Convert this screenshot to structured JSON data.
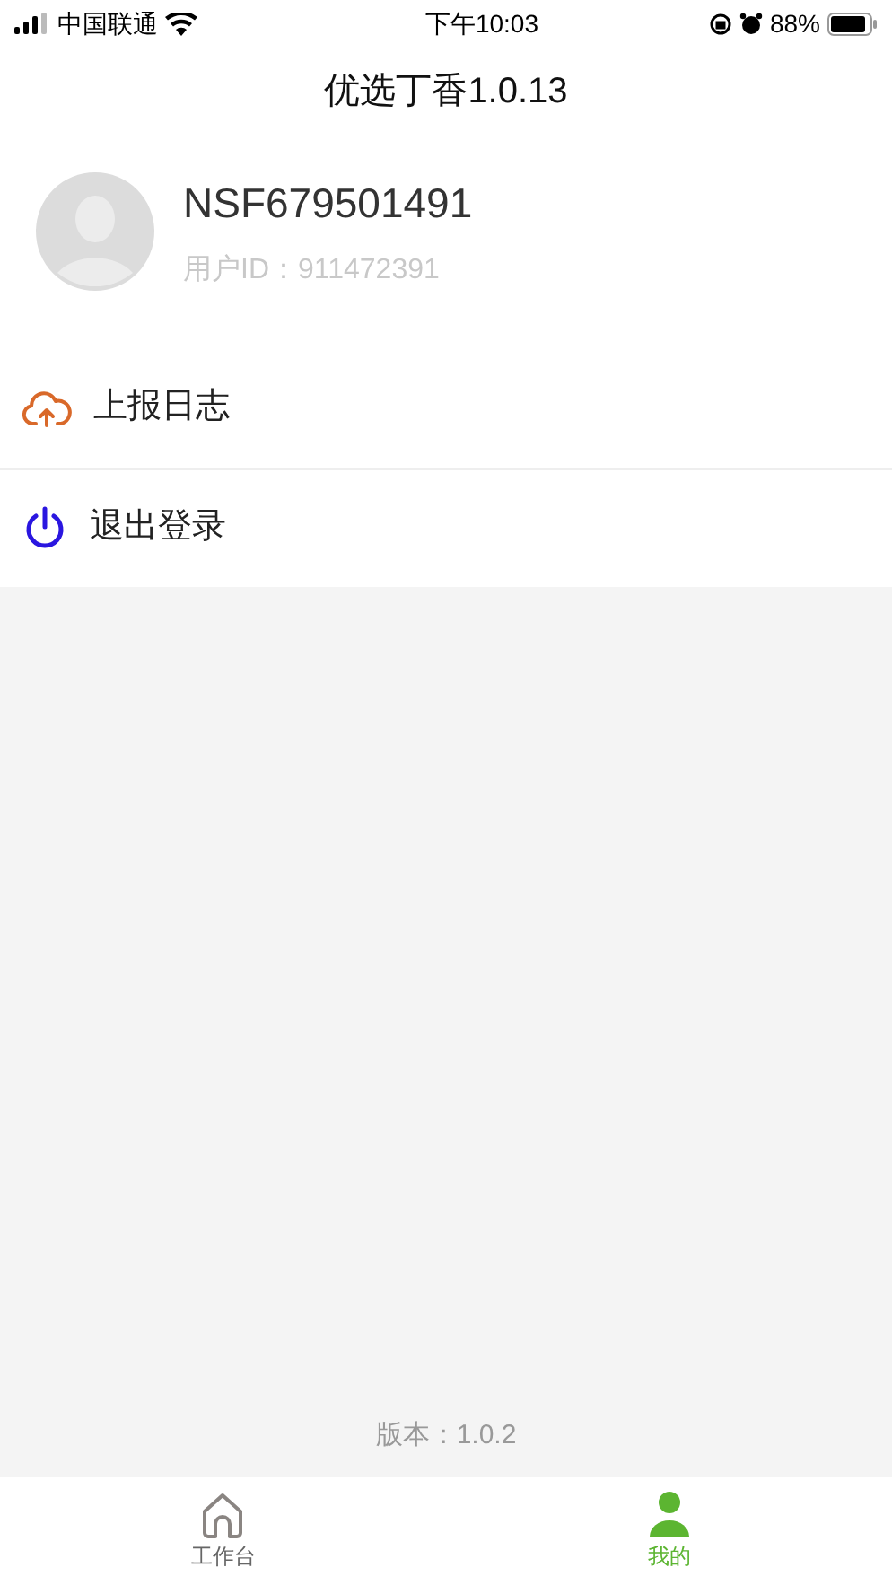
{
  "status_bar": {
    "carrier": "中国联通",
    "time": "下午10:03",
    "battery": "88%"
  },
  "header": {
    "title": "优选丁香1.0.13"
  },
  "profile": {
    "name": "NSF679501491",
    "user_id": "用户ID：911472391"
  },
  "menu": [
    {
      "kind": "upload",
      "label": "上报日志"
    },
    {
      "kind": "logout",
      "label": "退出登录"
    }
  ],
  "version": "版本：1.0.2",
  "tab_bar": [
    {
      "kind": "home",
      "label": "工作台",
      "selected": false
    },
    {
      "kind": "person",
      "label": "我的",
      "selected": true
    }
  ]
}
